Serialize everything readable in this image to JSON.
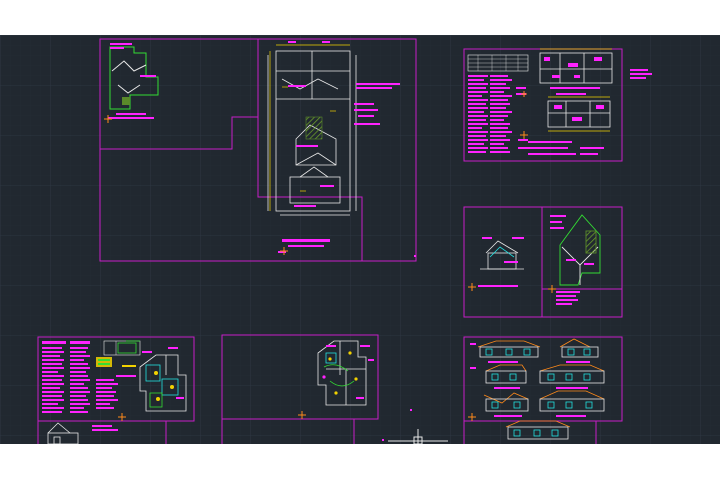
{
  "app": {
    "canvas": "cad-model-space",
    "background_color": "#212830",
    "grid_major_color": "#2c3540",
    "grid_minor_color": "#262d36",
    "sheet_border_color": "#c81ec8",
    "text_color": "#ff22ff",
    "line_color": "#e8e8e8",
    "accent_green": "#33dd33",
    "accent_yellow": "#f2d200",
    "accent_cyan": "#22e0e0",
    "accent_orange": "#ff8a1a",
    "hatch_green": "#5a8a2a"
  },
  "sheets": [
    {
      "id": "site-plan"
    },
    {
      "id": "energy-calculations"
    },
    {
      "id": "roof-details"
    },
    {
      "id": "notes-floor-plan"
    },
    {
      "id": "electrical-plan"
    },
    {
      "id": "elevations"
    }
  ],
  "cursor": {
    "icon": "crosshair-cursor-icon"
  }
}
